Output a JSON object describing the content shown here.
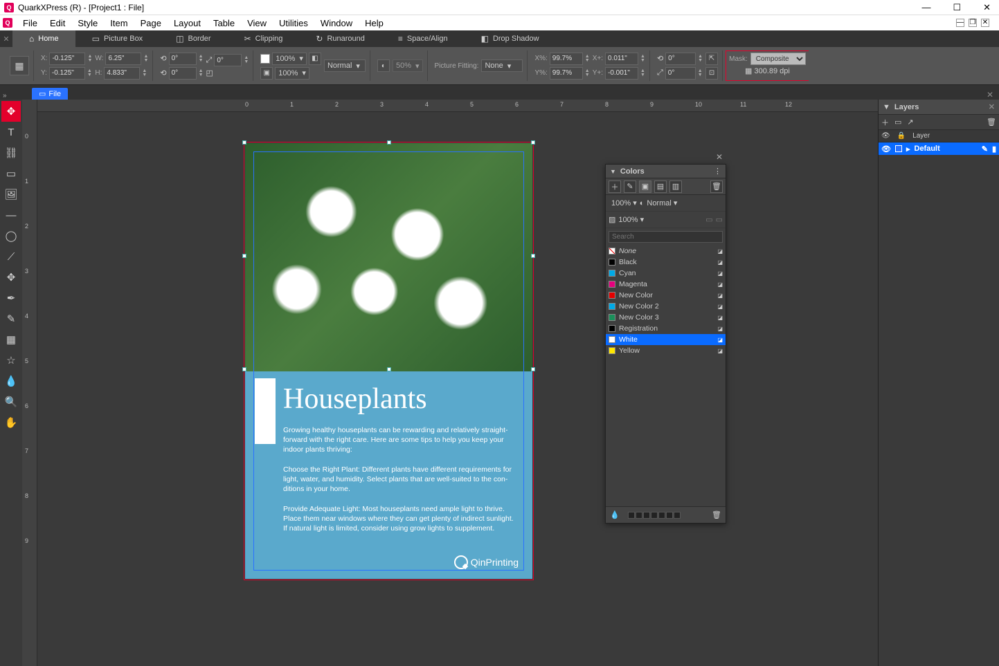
{
  "title": "QuarkXPress (R) - [Project1 : File]",
  "menu": [
    "File",
    "Edit",
    "Style",
    "Item",
    "Page",
    "Layout",
    "Table",
    "View",
    "Utilities",
    "Window",
    "Help"
  ],
  "ribbonTabs": [
    {
      "icon": "⌂",
      "label": "Home"
    },
    {
      "icon": "▭",
      "label": "Picture Box"
    },
    {
      "icon": "◫",
      "label": "Border"
    },
    {
      "icon": "✂",
      "label": "Clipping"
    },
    {
      "icon": "↻",
      "label": "Runaround"
    },
    {
      "icon": "≡",
      "label": "Space/Align"
    },
    {
      "icon": "◧",
      "label": "Drop Shadow"
    }
  ],
  "geom": {
    "x": "-0.125\"",
    "y": "-0.125\"",
    "w": "6.25\"",
    "h": "4.833\""
  },
  "rotate": {
    "a1": "0°",
    "a2": "0°"
  },
  "skew": {
    "v": "0°"
  },
  "opacity1": "100%",
  "opacity2": "100%",
  "blend": "Normal",
  "opacity3": "50%",
  "pictureFittingLabel": "Picture Fitting:",
  "pictureFitting": "None",
  "scale": {
    "xpLabel": "X%:",
    "xp": "99.7%",
    "ypLabel": "Y%:",
    "yp": "99.7%",
    "xoffLabel": "X+:",
    "xoff": "0.011\"",
    "yoffLabel": "Y+:",
    "yoff": "-0.001\""
  },
  "rot2": {
    "a": "0°",
    "b": "0°"
  },
  "maskLabel": "Mask:",
  "mask": "Composite",
  "dpi": "300.89 dpi",
  "docTab": "File",
  "doc": {
    "heading": "Houseplants",
    "p1": "Growing healthy houseplants can be rewarding and relatively straight-forward with the right care. Here are some tips to help you keep your indoor plants thriving:",
    "p2": "Choose the Right Plant: Different plants have different requirements for light, water, and humidity. Select plants that are well-suited to the con-ditions in your home.",
    "p3": "Provide Adequate Light: Most houseplants need ample light to thrive. Place them near windows where they can get plenty of indirect sunlight. If natural light is limited, consider using grow lights to supplement.",
    "logo": "QinPrinting"
  },
  "colorsPanel": {
    "title": "Colors",
    "opacity": "100%",
    "blend": "Normal",
    "opacity2": "100%",
    "searchPlaceholder": "Search",
    "items": [
      {
        "name": "None",
        "swatch": "none",
        "italic": true
      },
      {
        "name": "Black",
        "swatch": "#000"
      },
      {
        "name": "Cyan",
        "swatch": "#00a9e6"
      },
      {
        "name": "Magenta",
        "swatch": "#e5007e"
      },
      {
        "name": "New Color",
        "swatch": "#e40000"
      },
      {
        "name": "New Color 2",
        "swatch": "#00a9e6"
      },
      {
        "name": "New Color 3",
        "swatch": "#1b8f5a"
      },
      {
        "name": "Registration",
        "swatch": "#000"
      },
      {
        "name": "White",
        "swatch": "#fff",
        "selected": true
      },
      {
        "name": "Yellow",
        "swatch": "#ffe700"
      }
    ]
  },
  "layersPanel": {
    "title": "Layers",
    "header": "Layer",
    "items": [
      {
        "name": "Default"
      }
    ]
  }
}
